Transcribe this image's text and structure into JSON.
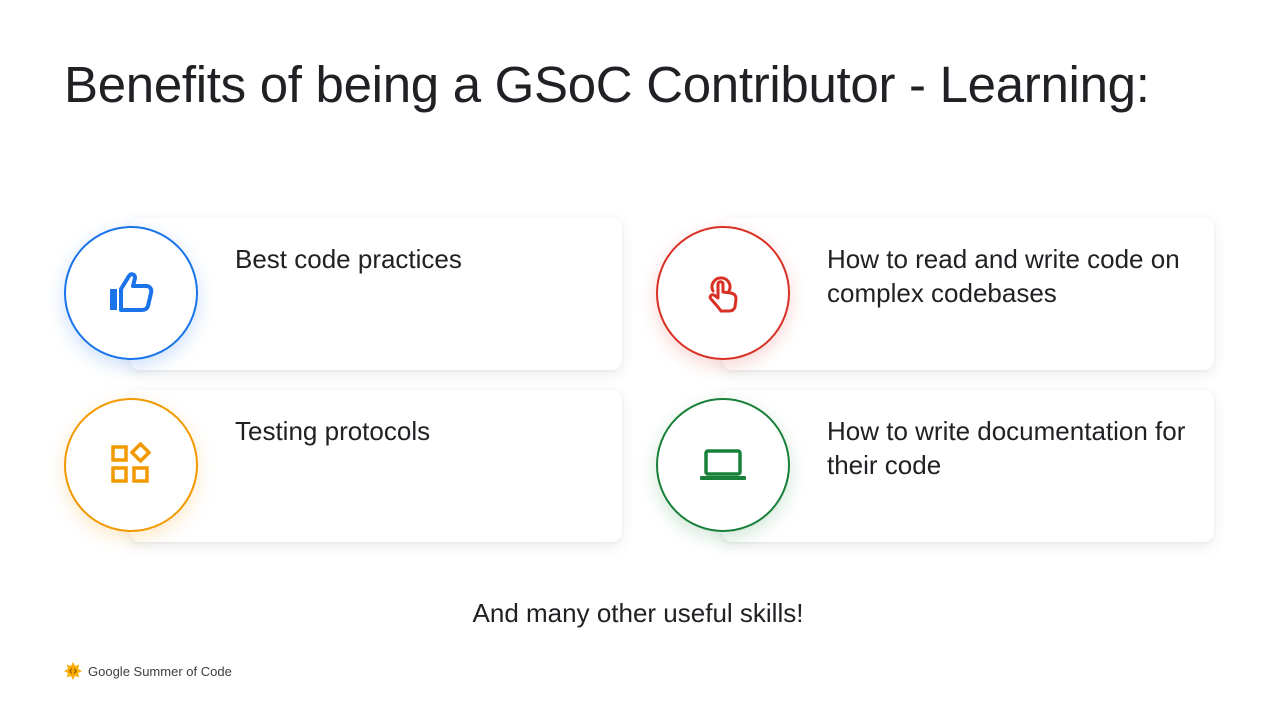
{
  "slide": {
    "title": "Benefits of being a GSoC Contributor - Learning:",
    "cards": [
      {
        "label": "Best code practices",
        "icon": "thumbs-up-icon",
        "color": "#1a73e8"
      },
      {
        "label": "How to read and write code on complex codebases",
        "icon": "touch-pointer-icon",
        "color": "#d93025"
      },
      {
        "label": "Testing protocols",
        "icon": "widgets-icon",
        "color": "#f29900"
      },
      {
        "label": "How to write documentation for their code",
        "icon": "laptop-icon",
        "color": "#188038"
      }
    ],
    "footer_text": "And many other useful skills!"
  },
  "brand": {
    "name": "Google Summer of Code",
    "icon": "gsoc-sun-logo-icon"
  }
}
